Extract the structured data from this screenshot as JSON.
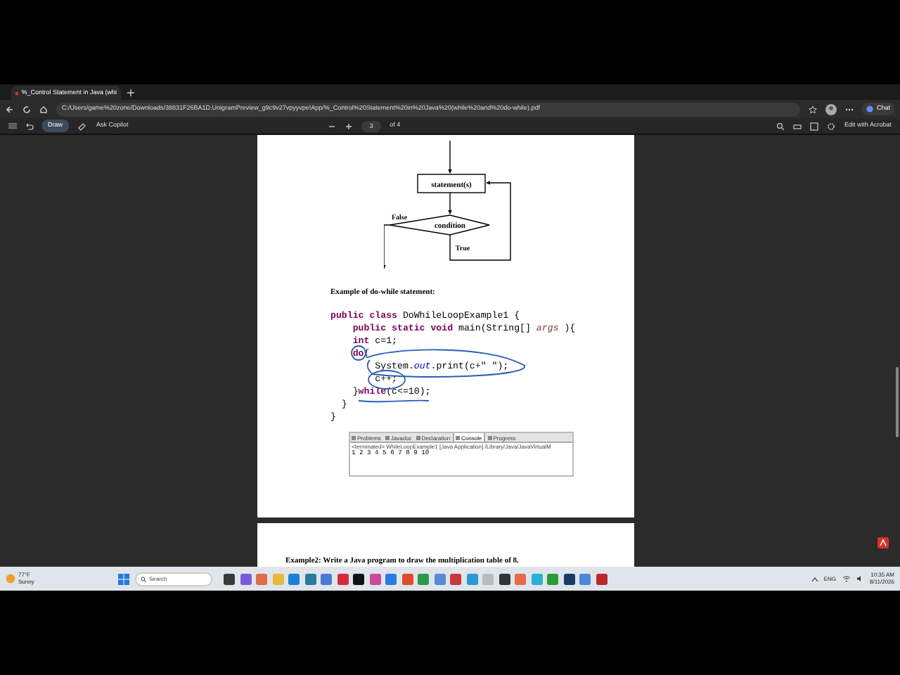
{
  "browser": {
    "tabs": [
      {
        "title": "%_Control Statement in Java (whi",
        "selected": true
      }
    ],
    "address": "C:/Users/game%20zone/Downloads/38831F26BA1D.UnigramPreview_g9c9v27vpyyvpe!App/%_Control%20Statement%20in%20Java%20(while%20and%20do-while).pdf",
    "chat": "Chat",
    "toolbar": {
      "draw": "Draw",
      "copilot": "Ask Copilot",
      "page": "3",
      "page_total": "of 4",
      "acrobat": "Edit with Acrobat"
    }
  },
  "document": {
    "flowchart": {
      "process": "statement(s)",
      "decision": "condition",
      "false_label": "False",
      "true_label": "True"
    },
    "heading": "Example of do-while statement:",
    "code": [
      [
        {
          "kind": "keyword",
          "text": "public class"
        },
        {
          "kind": "plain",
          "text": " DoWhileLoopExample1 {"
        }
      ],
      [
        {
          "kind": "keyword",
          "text": "    public static void"
        },
        {
          "kind": "plain",
          "text": " main(String[] "
        },
        {
          "kind": "param",
          "text": "args"
        },
        {
          "kind": "plain",
          "text": " ){"
        }
      ],
      [
        {
          "kind": "keyword",
          "text": "    int"
        },
        {
          "kind": "plain",
          "text": " c=1;"
        }
      ],
      [
        {
          "kind": "keyword",
          "text": "    do"
        },
        {
          "kind": "plain",
          "text": "{"
        }
      ],
      [
        {
          "kind": "plain",
          "text": "        System."
        },
        {
          "kind": "field",
          "text": "out"
        },
        {
          "kind": "plain",
          "text": ".print(c+\" \");"
        }
      ],
      [
        {
          "kind": "plain",
          "text": "        c++;"
        }
      ],
      [
        {
          "kind": "plain",
          "text": "    }"
        },
        {
          "kind": "keyword",
          "text": "while"
        },
        {
          "kind": "plain",
          "text": "(c<=10);"
        }
      ],
      [
        {
          "kind": "plain",
          "text": "  }"
        }
      ],
      [
        {
          "kind": "plain",
          "text": "}"
        }
      ]
    ],
    "console": {
      "tabs": [
        {
          "label": "Problems",
          "selected": false
        },
        {
          "label": "Javadoc",
          "selected": false
        },
        {
          "label": "Declaration",
          "selected": false
        },
        {
          "label": "Console",
          "selected": true
        },
        {
          "label": "Progress",
          "selected": false
        }
      ],
      "status": "<terminated> WhileLoopExample1 [Java Application] /Library/Java/JavaVirtualM",
      "output": "1 2 3 4 5 6 7 8 9 10"
    },
    "next_example": "Example2: Write a Java program to draw the multiplication table of 8."
  },
  "taskbar": {
    "weather": {
      "temperature": "77°F",
      "condition": "Sunny"
    },
    "search": "Search",
    "language": "ENG",
    "time": "10:35 AM",
    "date": "8/11/2026"
  }
}
